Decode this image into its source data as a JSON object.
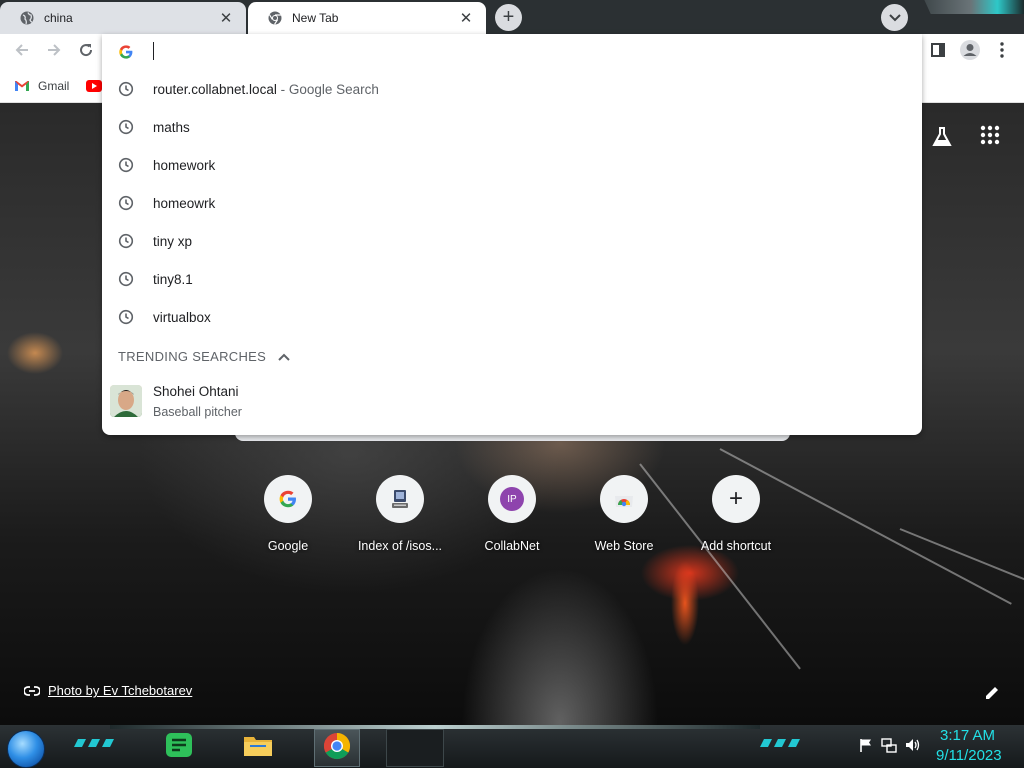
{
  "tabs": [
    {
      "title": "china",
      "active": false
    },
    {
      "title": "New Tab",
      "active": true
    }
  ],
  "tab_close_glyph": "✕",
  "new_tab_glyph": "+",
  "toolbar": {
    "back_icon": "arrow-left-icon",
    "forward_icon": "arrow-right-icon",
    "reload_icon": "reload-icon"
  },
  "bookmarks": [
    {
      "label": "Gmail",
      "icon": "gmail-icon"
    },
    {
      "label": "",
      "icon": "youtube-icon"
    }
  ],
  "omnibox": {
    "value": "",
    "suggestions": [
      {
        "text": "router.collabnet.local",
        "suffix": "Google Search",
        "sep": " - "
      },
      {
        "text": "maths"
      },
      {
        "text": "homework"
      },
      {
        "text": "homeowrk"
      },
      {
        "text": "tiny xp"
      },
      {
        "text": "tiny8.1"
      },
      {
        "text": "virtualbox"
      }
    ],
    "trending_header": "TRENDING SEARCHES",
    "trending": [
      {
        "title": "Shohei Ohtani",
        "subtitle": "Baseball pitcher"
      }
    ]
  },
  "shortcuts": [
    {
      "label": "Google",
      "icon": "google-icon"
    },
    {
      "label": "Index of /isos...",
      "icon": "server-icon"
    },
    {
      "label": "CollabNet",
      "icon_text": "IP",
      "icon_color": "#8e44ad"
    },
    {
      "label": "Web Store",
      "icon": "chrome-web-store-icon"
    },
    {
      "label": "Add shortcut",
      "icon_text": "+"
    }
  ],
  "photo_credit": "Photo by Ev Tchebotarev",
  "taskbar": {
    "time": "3:17 AM",
    "date": "9/11/2023",
    "accent": "#22e0e6"
  }
}
